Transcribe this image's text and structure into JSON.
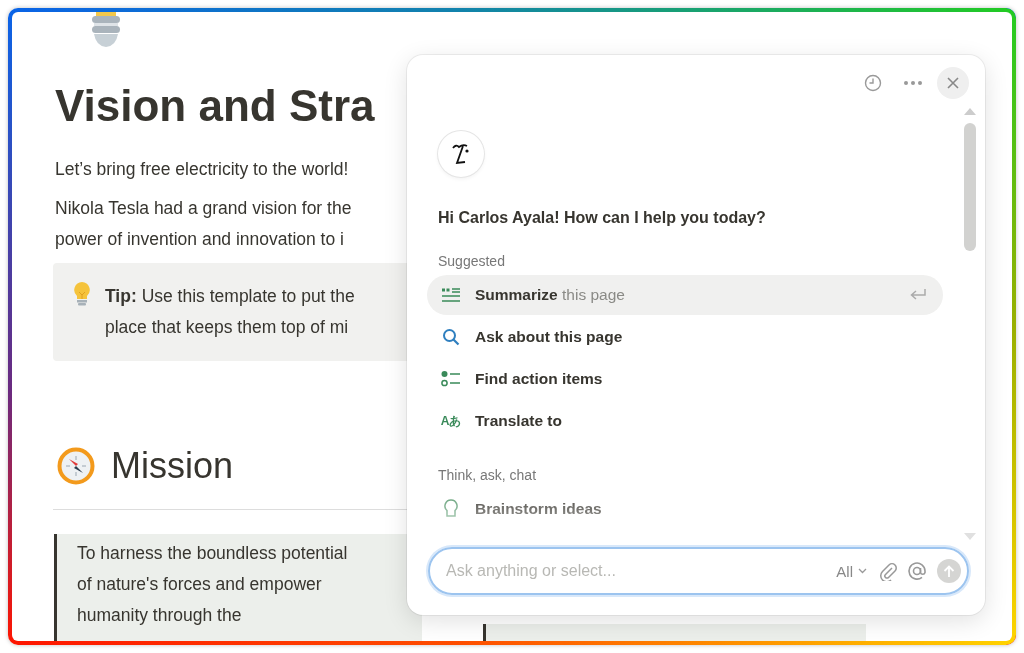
{
  "page": {
    "title": "Vision and Stra",
    "intro": "Let’s bring free electricity to the world!",
    "paragraph_lines": [
      "Nikola Tesla had a grand vision for the",
      "power of invention and innovation to i"
    ],
    "callout_lines": [
      "**Tip:** Use this template to put the",
      "place that keeps them top of mi"
    ],
    "section_heading": "Mission",
    "quote_lines": [
      "To harness the boundless potential",
      "of nature's forces and empower",
      "humanity through the"
    ]
  },
  "assistant": {
    "greeting": "Hi Carlos Ayala! How can I help you today?",
    "groups": [
      {
        "heading": "Suggested",
        "items": [
          {
            "kind": "summarize",
            "label": "Summarize",
            "suffix": "this page",
            "selected": true
          },
          {
            "kind": "search",
            "label": "Ask about this page",
            "selected": false
          },
          {
            "kind": "checklist",
            "label": "Find action items",
            "selected": false
          },
          {
            "kind": "translate",
            "icon_text": "Aあ",
            "label": "Translate to",
            "selected": false
          }
        ]
      },
      {
        "heading": "Think, ask, chat",
        "items": [
          {
            "kind": "brainstorm",
            "label": "Brainstorm ideas",
            "selected": false
          }
        ]
      }
    ],
    "input": {
      "placeholder": "Ask anything or select...",
      "scope": "All"
    }
  }
}
